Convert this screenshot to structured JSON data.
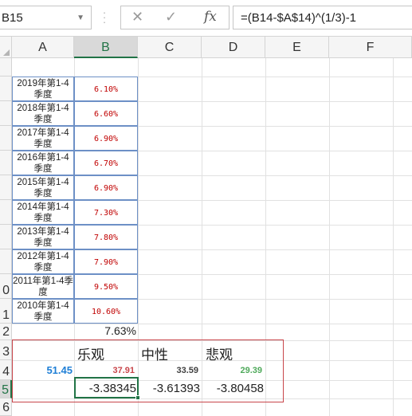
{
  "formula_bar": {
    "name_box": "B15",
    "formula": "=(B14-$A$14)^(1/3)-1",
    "cancel_icon": "✕",
    "enter_icon": "✓",
    "fx_label": "fx"
  },
  "columns": [
    "A",
    "B",
    "C",
    "D",
    "E",
    "F"
  ],
  "rows": [
    "",
    "",
    "",
    "",
    "",
    "",
    "",
    "",
    "",
    "0",
    "1",
    "2",
    "3",
    "4",
    "5",
    "6"
  ],
  "quarter_rows": [
    {
      "label": "2019年第1-4季度",
      "rate": "6.10%"
    },
    {
      "label": "2018年第1-4季度",
      "rate": "6.60%"
    },
    {
      "label": "2017年第1-4季度",
      "rate": "6.90%"
    },
    {
      "label": "2016年第1-4季度",
      "rate": "6.70%"
    },
    {
      "label": "2015年第1-4季度",
      "rate": "6.90%"
    },
    {
      "label": "2014年第1-4季度",
      "rate": "7.30%"
    },
    {
      "label": "2013年第1-4季度",
      "rate": "7.80%"
    },
    {
      "label": "2012年第1-4季度",
      "rate": "7.90%"
    },
    {
      "label": "2011年第1-4季度",
      "rate": "9.50%"
    },
    {
      "label": "2010年第1-4季度",
      "rate": "10.60%"
    }
  ],
  "average": "7.63%",
  "scenarios": {
    "optimistic": "乐观",
    "neutral": "中性",
    "pessimistic": "悲观"
  },
  "row14": {
    "a": "51.45",
    "b": "37.91",
    "c": "33.59",
    "d": "29.39"
  },
  "row15": {
    "b": "-3.38345",
    "c": "-3.61393",
    "d": "-3.80458"
  },
  "colors": {
    "blue": "#1f7fd6",
    "red": "#c8454a",
    "dark": "#404040",
    "green": "#4ea95a",
    "accent": "#217346"
  }
}
